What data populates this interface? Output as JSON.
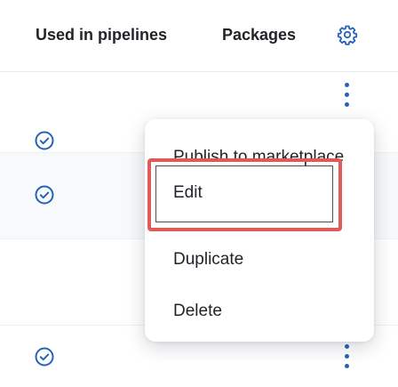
{
  "header": {
    "used_in_pipelines": "Used in pipelines",
    "packages": "Packages",
    "settings_icon": "gear-icon"
  },
  "rows": [
    {
      "used_in_pipelines": true
    },
    {
      "used_in_pipelines": true
    },
    {
      "used_in_pipelines": true
    }
  ],
  "context_menu": {
    "items": [
      {
        "label": "Publish to marketplace"
      },
      {
        "label": "Edit",
        "highlighted": true
      },
      {
        "label": "Duplicate"
      },
      {
        "label": "Delete"
      }
    ]
  },
  "colors": {
    "accent": "#2563b8",
    "highlight": "#e05a5a"
  }
}
